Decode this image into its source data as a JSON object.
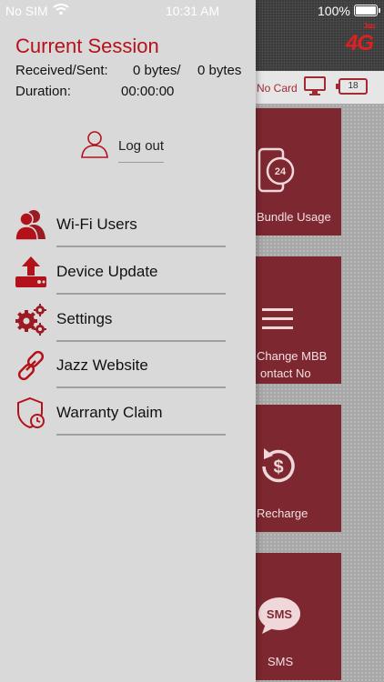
{
  "status_bar": {
    "carrier": "No SIM",
    "time": "10:31 AM",
    "battery": "100%"
  },
  "background": {
    "logo_text": "4G",
    "logo_sup": "Jazz",
    "no_card": "No Card",
    "device_battery": "18",
    "tiles": [
      {
        "label_lines": [
          "Bundle Usage"
        ],
        "icon": "phone-24-icon"
      },
      {
        "label_lines": [
          "Change MBB",
          "ontact No"
        ],
        "icon": "hamburger-icon"
      },
      {
        "label_lines": [
          "Recharge"
        ],
        "icon": "dollar-refresh-icon"
      },
      {
        "label_lines": [
          "SMS"
        ],
        "icon": "sms-bubble-icon"
      }
    ]
  },
  "drawer": {
    "session_title": "Current Session",
    "received_sent_label": "Received/Sent:",
    "received_value": "0 bytes/",
    "sent_value": "0 bytes",
    "duration_label": "Duration:",
    "duration_value": "00:00:00",
    "logout_label": "Log out",
    "menu": [
      {
        "label": "Wi-Fi Users",
        "icon": "users-icon"
      },
      {
        "label": "Device Update",
        "icon": "upload-icon"
      },
      {
        "label": "Settings",
        "icon": "gears-icon"
      },
      {
        "label": "Jazz Website",
        "icon": "link-icon"
      },
      {
        "label": "Warranty Claim",
        "icon": "shield-clock-icon"
      }
    ]
  },
  "colors": {
    "accent": "#b4121b",
    "tile": "#7d2730",
    "drawer_bg": "#d9d9d9"
  }
}
